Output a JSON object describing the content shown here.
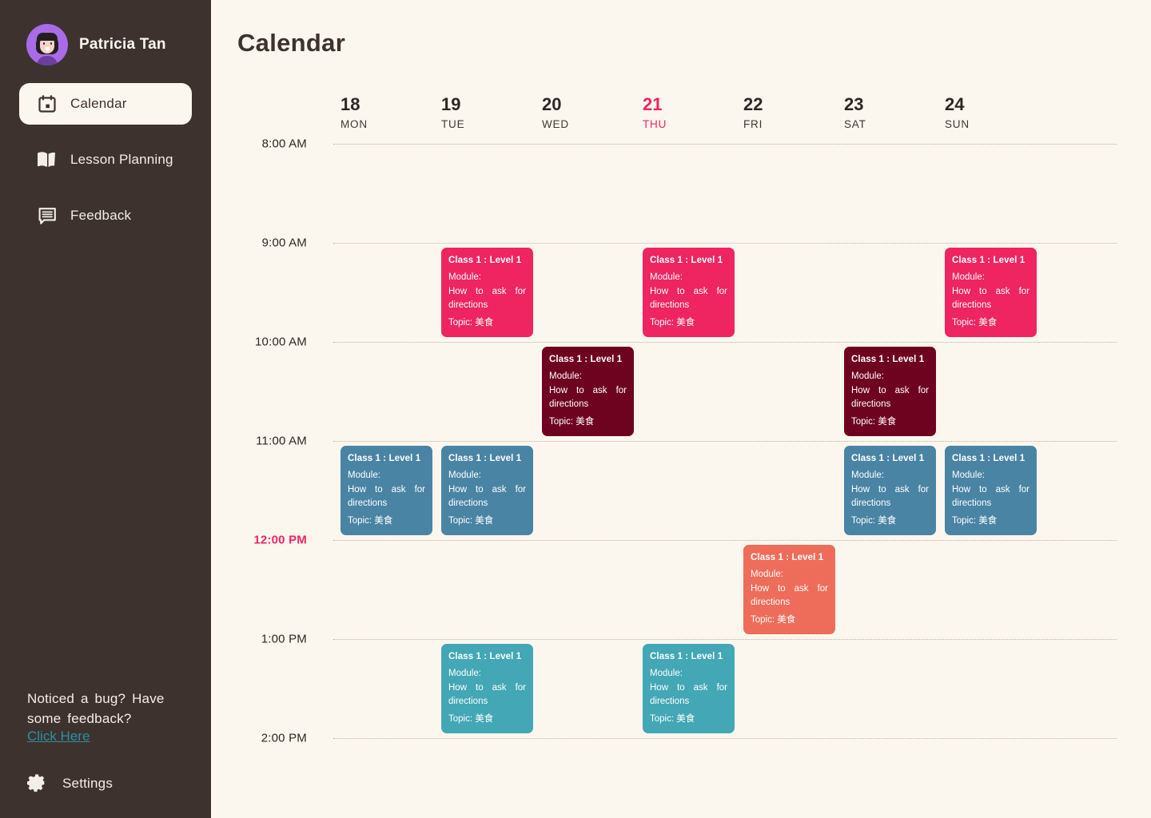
{
  "sidebar": {
    "profile": {
      "name": "Patricia Tan",
      "avatar_icon": "user-avatar-icon"
    },
    "items": [
      {
        "label": "Calendar",
        "icon": "calendar-icon",
        "active": true
      },
      {
        "label": "Lesson Planning",
        "icon": "open-book-icon",
        "active": false
      },
      {
        "label": "Feedback",
        "icon": "chat-message-icon",
        "active": false
      }
    ],
    "bug_prompt_line1": "Noticed a bug? Have",
    "bug_prompt_line2": "some   feedback?",
    "bug_link_label": "Click Here",
    "settings_label": "Settings",
    "settings_icon": "gear-icon",
    "bg_color": "#3E322F",
    "link_color": "#2C8FA3"
  },
  "header": {
    "title": "Calendar"
  },
  "calendar": {
    "accent_color": "#EE2560",
    "background": "#FBF7EF",
    "days": [
      {
        "num": "18",
        "dow": "MON",
        "today": false
      },
      {
        "num": "19",
        "dow": "TUE",
        "today": false
      },
      {
        "num": "20",
        "dow": "WED",
        "today": false
      },
      {
        "num": "21",
        "dow": "THU",
        "today": true
      },
      {
        "num": "22",
        "dow": "FRI",
        "today": false
      },
      {
        "num": "23",
        "dow": "SAT",
        "today": false
      },
      {
        "num": "24",
        "dow": "SUN",
        "today": false
      }
    ],
    "times": [
      {
        "label": "8:00 AM",
        "highlight": false
      },
      {
        "label": "9:00 AM",
        "highlight": false
      },
      {
        "label": "10:00 AM",
        "highlight": false
      },
      {
        "label": "11:00 AM",
        "highlight": false
      },
      {
        "label": "12:00 PM",
        "highlight": true
      },
      {
        "label": "1:00 PM",
        "highlight": false
      },
      {
        "label": "2:00 PM",
        "highlight": false
      }
    ],
    "events": [
      {
        "day": 1,
        "start": "9:00 AM",
        "end": "10:00 AM",
        "title": "Class 1 : Level 1",
        "module_label": "Module:",
        "module_body": "How to ask for directions",
        "topic": "Topic: 美食",
        "color": "#EE2560"
      },
      {
        "day": 3,
        "start": "9:00 AM",
        "end": "10:00 AM",
        "title": "Class 1 : Level 1",
        "module_label": "Module:",
        "module_body": "How to ask for directions",
        "topic": "Topic: 美食",
        "color": "#EE2560"
      },
      {
        "day": 6,
        "start": "9:00 AM",
        "end": "10:00 AM",
        "title": "Class 1 : Level 1",
        "module_label": "Module:",
        "module_body": "How to ask for directions",
        "topic": "Topic: 美食",
        "color": "#EE2560"
      },
      {
        "day": 2,
        "start": "10:00 AM",
        "end": "11:00 AM",
        "title": "Class 1 : Level 1",
        "module_label": "Module:",
        "module_body": "How to ask for directions",
        "topic": "Topic: 美食",
        "color": "#6E0320"
      },
      {
        "day": 5,
        "start": "10:00 AM",
        "end": "11:00 AM",
        "title": "Class 1 : Level 1",
        "module_label": "Module:",
        "module_body": "How to ask for directions",
        "topic": "Topic: 美食",
        "color": "#6E0320"
      },
      {
        "day": 0,
        "start": "11:00 AM",
        "end": "12:00 PM",
        "title": "Class 1 : Level 1",
        "module_label": "Module:",
        "module_body": "How to ask for directions",
        "topic": "Topic: 美食",
        "color": "#4A84A4"
      },
      {
        "day": 1,
        "start": "11:00 AM",
        "end": "12:00 PM",
        "title": "Class 1 : Level 1",
        "module_label": "Module:",
        "module_body": "How to ask for directions",
        "topic": "Topic: 美食",
        "color": "#4A84A4"
      },
      {
        "day": 5,
        "start": "11:00 AM",
        "end": "12:00 PM",
        "title": "Class 1 : Level 1",
        "module_label": "Module:",
        "module_body": "How to ask for directions",
        "topic": "Topic: 美食",
        "color": "#4A84A4"
      },
      {
        "day": 6,
        "start": "11:00 AM",
        "end": "12:00 PM",
        "title": "Class 1 : Level 1",
        "module_label": "Module:",
        "module_body": "How to ask for directions",
        "topic": "Topic: 美食",
        "color": "#4A84A4"
      },
      {
        "day": 4,
        "start": "12:00 PM",
        "end": "1:00 PM",
        "title": "Class 1 : Level 1",
        "module_label": "Module:",
        "module_body": "How to ask for directions",
        "topic": "Topic: 美食",
        "color": "#EE6D5A"
      },
      {
        "day": 1,
        "start": "1:00 PM",
        "end": "2:00 PM",
        "title": "Class 1 : Level 1",
        "module_label": "Module:",
        "module_body": "How to ask for directions",
        "topic": "Topic: 美食",
        "color": "#43A7B5"
      },
      {
        "day": 3,
        "start": "1:00 PM",
        "end": "2:00 PM",
        "title": "Class 1 : Level 1",
        "module_label": "Module:",
        "module_body": "How to ask for directions",
        "topic": "Topic: 美食",
        "color": "#43A7B5"
      }
    ]
  }
}
